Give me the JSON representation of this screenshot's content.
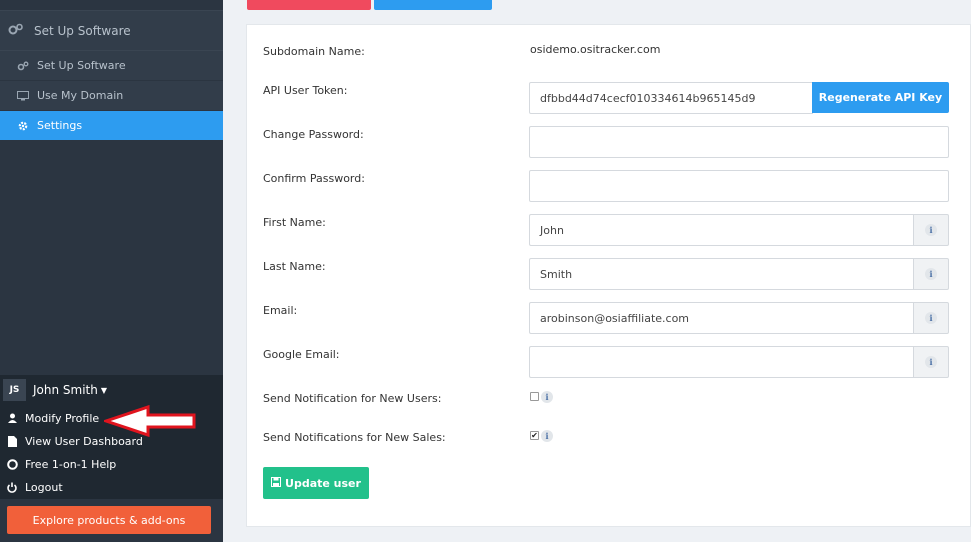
{
  "sidebar": {
    "section_title": "Set Up Software",
    "items": [
      {
        "label": "Set Up Software",
        "icon": "gears-icon"
      },
      {
        "label": "Use My Domain",
        "icon": "monitor-icon"
      },
      {
        "label": "Settings",
        "icon": "gear-icon",
        "active": true
      }
    ],
    "user": {
      "initials": "JS",
      "name": "John Smith"
    },
    "menu": [
      {
        "label": "Modify Profile",
        "icon": "user-icon"
      },
      {
        "label": "View User Dashboard",
        "icon": "document-icon"
      },
      {
        "label": "Free 1-on-1 Help",
        "icon": "lifebuoy-icon"
      },
      {
        "label": "Logout",
        "icon": "power-icon"
      }
    ],
    "explore_label": "Explore products & add-ons"
  },
  "form": {
    "subdomain_label": "Subdomain Name:",
    "subdomain_value": "osidemo.ositracker.com",
    "api_label": "API User Token:",
    "api_value": "dfbbd44d74cecf010334614b965145d9",
    "regenerate_label": "Regenerate API Key",
    "change_password_label": "Change Password:",
    "change_password_value": "",
    "confirm_password_label": "Confirm Password:",
    "confirm_password_value": "",
    "first_name_label": "First Name:",
    "first_name_value": "John",
    "last_name_label": "Last Name:",
    "last_name_value": "Smith",
    "email_label": "Email:",
    "email_value": "arobinson@osiaffiliate.com",
    "google_email_label": "Google Email:",
    "google_email_value": "",
    "notify_users_label": "Send Notification for New Users:",
    "notify_users_checked": false,
    "notify_sales_label": "Send Notifications for New Sales:",
    "notify_sales_checked": true,
    "info_glyph": "i",
    "update_label": "Update user"
  },
  "colors": {
    "sidebar_bg": "#2b3541",
    "active_blue": "#2d9cf0",
    "explore_orange": "#f1603a",
    "update_green": "#22c18b",
    "top_red": "#f04a5e",
    "arrow_red": "#e0141e"
  }
}
